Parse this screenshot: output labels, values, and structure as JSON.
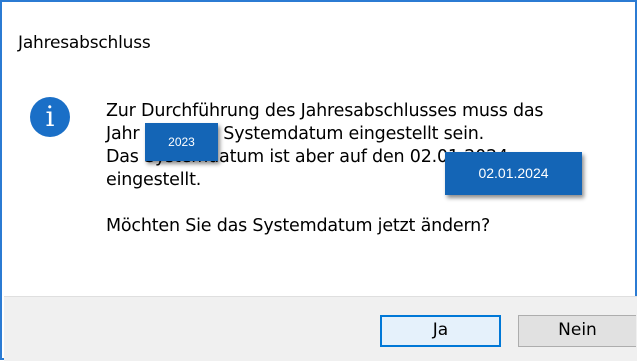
{
  "dialog": {
    "title": "Jahresabschluss",
    "icon": "info-icon",
    "icon_glyph": "i",
    "message_lines": [
      "Zur Durchführung des Jahresabschlusses muss das",
      "Jahr 2023 als Systemdatum eingestellt sein.",
      "Das Systemdatum ist aber auf den 02.01.2024",
      "eingestellt."
    ],
    "question": "Möchten Sie das Systemdatum jetzt ändern?"
  },
  "overlays": {
    "year": "2023",
    "date": "02.01.2024"
  },
  "buttons": {
    "yes_label": "Ja",
    "no_label": "Nein"
  },
  "colors": {
    "accent": "#0078d7",
    "info_icon": "#1a6fc7",
    "overlay_box": "#1465b6",
    "footer_bg": "#f0f0f0"
  }
}
